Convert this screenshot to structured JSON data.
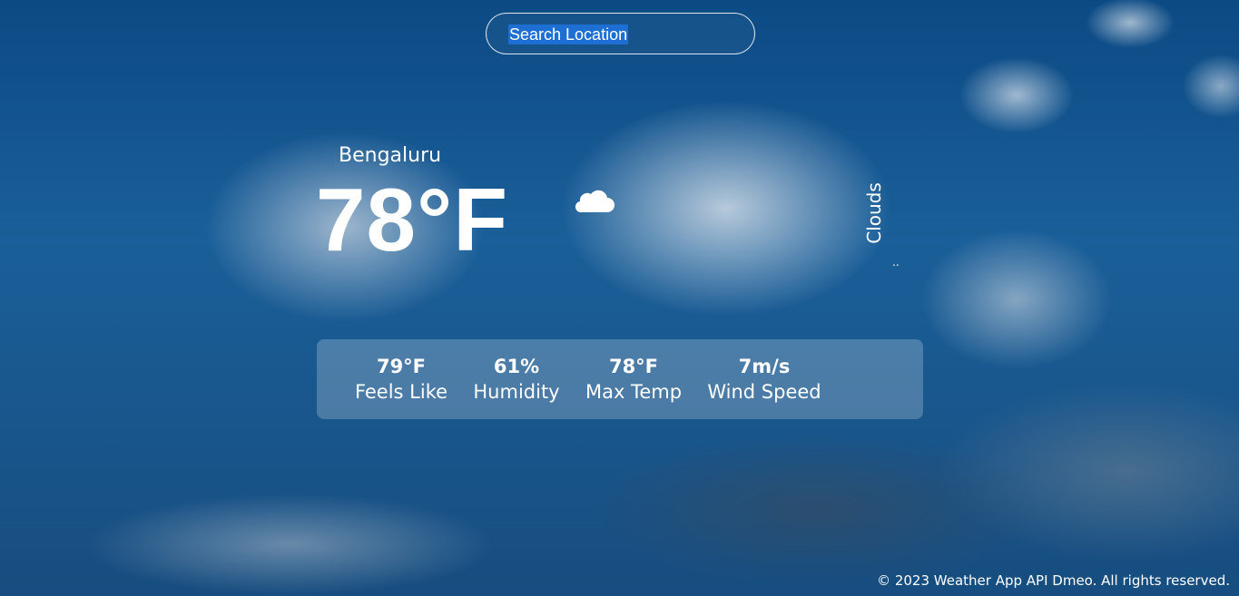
{
  "search": {
    "placeholder": "Search Location",
    "value": "Search Location"
  },
  "weather": {
    "city": "Bengaluru",
    "temperature": "78°F",
    "condition_icon": "cloud-icon",
    "condition": "Clouds",
    "dots": ".."
  },
  "stats": [
    {
      "value": "79°F",
      "label": "Feels Like"
    },
    {
      "value": "61%",
      "label": "Humidity"
    },
    {
      "value": "78°F",
      "label": "Max Temp"
    },
    {
      "value": "7m/s",
      "label": "Wind Speed"
    }
  ],
  "footer": {
    "text": "© 2023 Weather App API Dmeo. All rights reserved."
  },
  "colors": {
    "sky": "#1a5f99",
    "text": "#ffffff",
    "selection": "#1d6fd3"
  }
}
